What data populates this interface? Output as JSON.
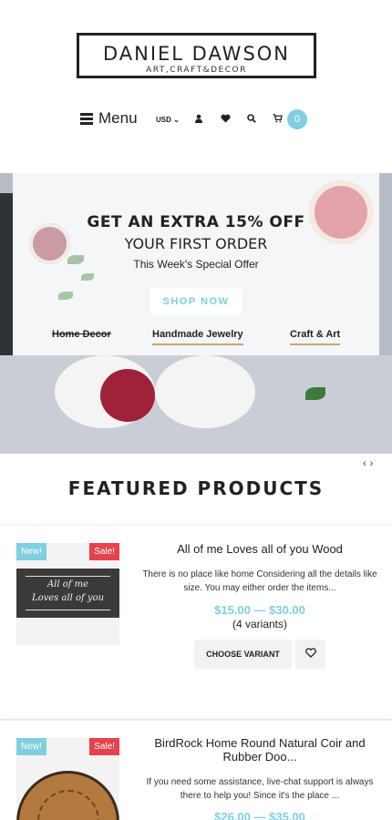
{
  "header": {
    "brand_name": "DANIEL DAWSON",
    "brand_tagline": "ART,CRAFT&DECOR",
    "menu_label": "Menu",
    "currency": "USD",
    "cart_count": "0"
  },
  "hero": {
    "line1": "GET AN EXTRA 15% OFF",
    "line2": "YOUR FIRST ORDER",
    "line3": "This Week's Special Offer",
    "cta_label": "SHOP NOW",
    "categories": [
      "Home Decor",
      "Handmade Jewelry",
      "Craft & Art"
    ],
    "slider_prev": "‹",
    "slider_next": "›"
  },
  "featured": {
    "title": "FEATURED PRODUCTS",
    "products": [
      {
        "badge_new": "New!",
        "badge_sale": "Sale!",
        "thumb_text_1": "All of me",
        "thumb_text_2": "Loves all of you",
        "title": "All of me Loves all of you Wood",
        "description": "There is no place like home Considering all the details like size. You may either order the items...",
        "price": "$15.00 — $30.00",
        "variants": "(4 variants)",
        "choose_label": "CHOOSE VARIANT"
      },
      {
        "badge_new": "New!",
        "badge_sale": "Sale!",
        "title": "BirdRock Home Round Natural Coir and Rubber Doo...",
        "description": "If you need some assistance, live-chat support is always there to help you! Since it's the place ...",
        "price": "$26.00 — $35.00"
      }
    ]
  },
  "icons": {
    "user": "user-icon",
    "heart": "heart-icon",
    "search": "search-icon",
    "cart": "cart-icon"
  },
  "colors": {
    "accent": "#7fcfe0",
    "sale": "#e5424d",
    "underline": "#c9a672"
  }
}
